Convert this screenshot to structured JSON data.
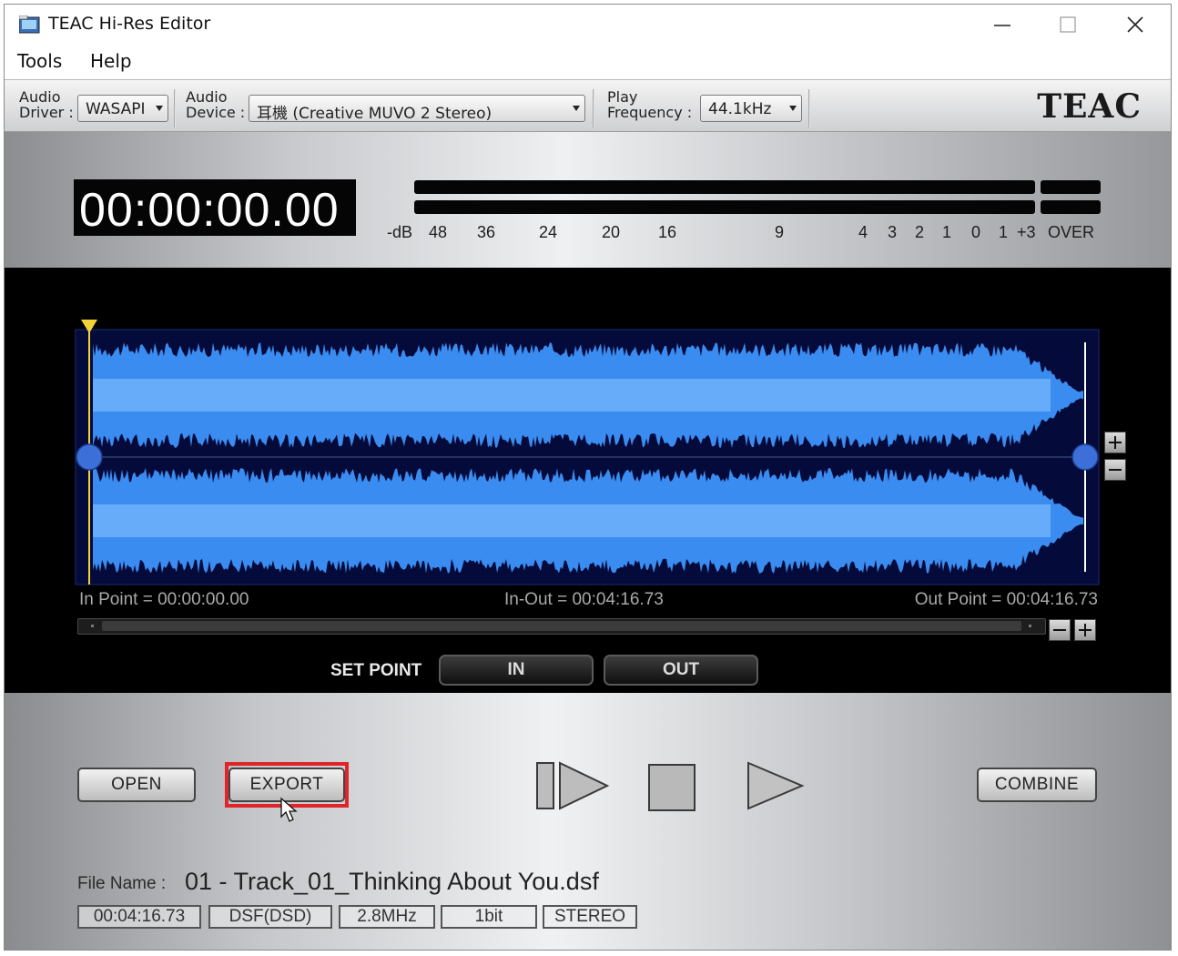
{
  "window": {
    "title": "TEAC Hi-Res Editor",
    "icons": [
      "app-icon",
      "minimize-icon",
      "maximize-icon",
      "close-icon"
    ]
  },
  "menu": {
    "items": [
      "Tools",
      "Help"
    ]
  },
  "toolbar": {
    "audio_driver_label_1": "Audio",
    "audio_driver_label_2": "Driver :",
    "audio_driver_value": "WASAPI",
    "audio_device_label_1": "Audio",
    "audio_device_label_2": "Device :",
    "audio_device_value": "耳機 (Creative MUVO 2 Stereo)",
    "play_freq_label_1": "Play",
    "play_freq_label_2": "Frequency :",
    "play_freq_value": "44.1kHz",
    "brand": "TEAC"
  },
  "display": {
    "timecode": "00:00:00.00",
    "meter_scale": [
      "-dB",
      "48",
      "36",
      "24",
      "20",
      "16",
      "9",
      "4",
      "3",
      "2",
      "1",
      "0",
      "1",
      "+3",
      "OVER"
    ]
  },
  "waveform": {
    "color": "#3a8cf0",
    "in_point_label": "In Point = 00:00:00.00",
    "in_out_label": "In-Out = 00:04:16.73",
    "out_point_label": "Out Point = 00:04:16.73",
    "set_point_label": "SET POINT",
    "in_button": "IN",
    "out_button": "OUT"
  },
  "controls": {
    "open_button": "OPEN",
    "export_button": "EXPORT",
    "combine_button": "COMBINE",
    "highlight_color": "#e0242a",
    "transport_icons": [
      "play-from-start-icon",
      "stop-icon",
      "play-icon"
    ]
  },
  "file_info": {
    "file_name_label": "File Name :",
    "file_name": "01 - Track_01_Thinking About You.dsf",
    "duration": "00:04:16.73",
    "format": "DSF(DSD)",
    "sample_rate": "2.8MHz",
    "bit_depth": "1bit",
    "channels": "STEREO"
  }
}
